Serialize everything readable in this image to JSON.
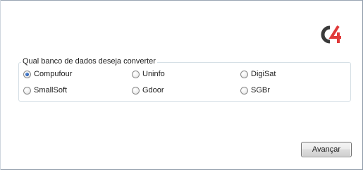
{
  "logo": {
    "icon": "c4-logo-icon",
    "colors": {
      "dark": "#3a3a3a",
      "accent": "#e03a3a"
    }
  },
  "group": {
    "legend": "Qual banco de dados deseja converter"
  },
  "options": [
    {
      "label": "Compufour",
      "checked": true
    },
    {
      "label": "Uninfo",
      "checked": false
    },
    {
      "label": "DigiSat",
      "checked": false
    },
    {
      "label": "SmallSoft",
      "checked": false
    },
    {
      "label": "Gdoor",
      "checked": false
    },
    {
      "label": "SGBr",
      "checked": false
    }
  ],
  "buttons": {
    "next_label": "Avançar"
  }
}
